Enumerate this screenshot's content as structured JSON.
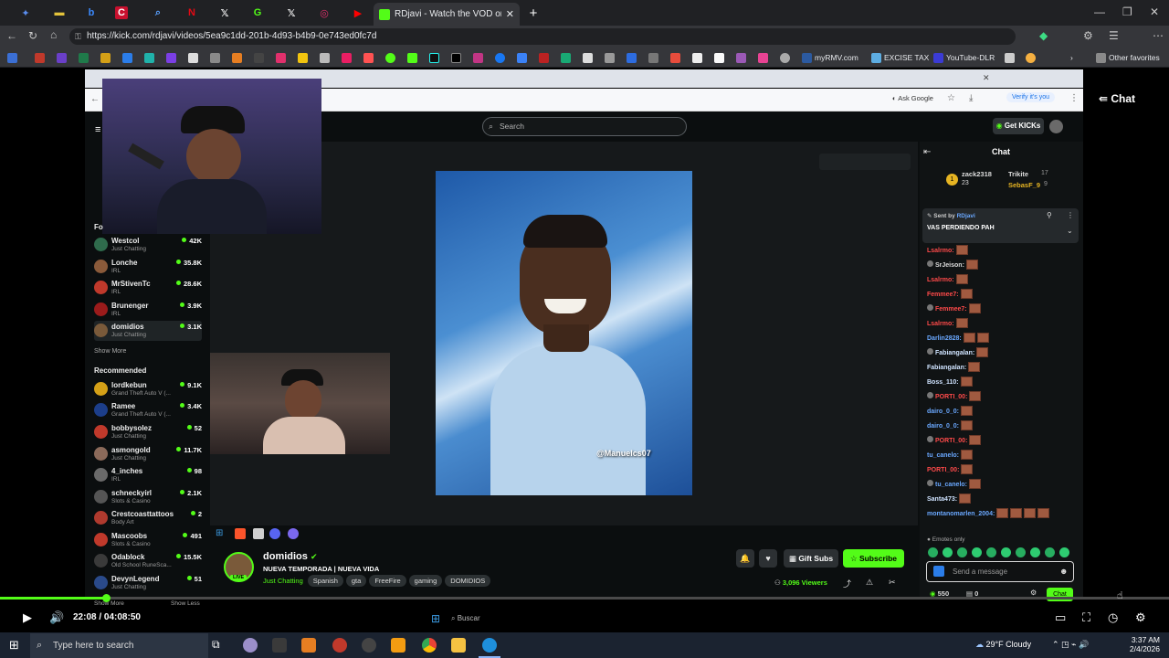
{
  "browser": {
    "active_tab_title": "RDjavi - Watch the VOD on Kick",
    "url": "https://kick.com/rdjavi/videos/5ea9c1dd-201b-4d93-b4b9-0e743ed0fc7d",
    "bookmarks": [
      "myRMV.com",
      "EXCISE TAX",
      "YouTube-DLR"
    ],
    "other_favorites": "Other favorites"
  },
  "inner_browser": {
    "ask_google": "Ask Google",
    "verify": "Verify it's you"
  },
  "kick": {
    "search_placeholder": "Search",
    "get_kicks": "Get KICKs",
    "chat_title": "Chat",
    "chat_header_button": "Chat"
  },
  "sidebar": {
    "followed_label": "Fo",
    "followed": [
      {
        "name": "Westcol",
        "category": "Just Chatting",
        "viewers": "42K"
      },
      {
        "name": "Lonche",
        "category": "IRL",
        "viewers": "35.8K"
      },
      {
        "name": "MrStivenTc",
        "category": "IRL",
        "viewers": "28.6K"
      },
      {
        "name": "Brunenger",
        "category": "IRL",
        "viewers": "3.9K"
      },
      {
        "name": "domidios",
        "category": "Just Chatting",
        "viewers": "3.1K"
      }
    ],
    "show_more": "Show More",
    "recommended_label": "Recommended",
    "recommended": [
      {
        "name": "lordkebun",
        "category": "Grand Theft Auto V (...",
        "viewers": "9.1K"
      },
      {
        "name": "Ramee",
        "category": "Grand Theft Auto V (...",
        "viewers": "3.4K"
      },
      {
        "name": "bobbysolez",
        "category": "Just Chatting",
        "viewers": "52"
      },
      {
        "name": "asmongold",
        "category": "Just Chatting",
        "viewers": "11.7K"
      },
      {
        "name": "4_inches",
        "category": "IRL",
        "viewers": "98"
      },
      {
        "name": "schneckyirl",
        "category": "Slots & Casino",
        "viewers": "2.1K"
      },
      {
        "name": "Crestcoasttattoos",
        "category": "Body Art",
        "viewers": "2"
      },
      {
        "name": "Mascoobs",
        "category": "Slots & Casino",
        "viewers": "491"
      },
      {
        "name": "Odablock",
        "category": "Old School RuneSca...",
        "viewers": "15.5K"
      },
      {
        "name": "DevynLegend",
        "category": "Just Chatting",
        "viewers": "51"
      }
    ],
    "show_more_2": "Show More",
    "show_less": "Show Less"
  },
  "chat": {
    "top_gifters": [
      {
        "name": "zack2318",
        "count": "23"
      },
      {
        "name": "Trikite",
        "count": "17"
      },
      {
        "name": "SebasF_9",
        "count": "9"
      }
    ],
    "pinned_sent_by": "Sent by",
    "pinned_user": "RDjavi",
    "pinned_text": "VAS PERDIENDO PAH",
    "messages": [
      {
        "user": "Lsalrmo:",
        "color": "#ff4a4a"
      },
      {
        "user": "SrJeison:",
        "color": "#dddddd"
      },
      {
        "user": "Lsalrmo:",
        "color": "#ff4a4a"
      },
      {
        "user": "Femmee7:",
        "color": "#ff4a4a"
      },
      {
        "user": "Femmee7:",
        "color": "#ff4a4a"
      },
      {
        "user": "Lsalrmo:",
        "color": "#ff4a4a"
      },
      {
        "user": "Darlin2828:",
        "color": "#6aa8ff"
      },
      {
        "user": "Fabiangalan:",
        "color": "#cfe3ff"
      },
      {
        "user": "Fabiangalan:",
        "color": "#cfe3ff"
      },
      {
        "user": "Boss_110:",
        "color": "#cfe3ff"
      },
      {
        "user": "PORTI_00:",
        "color": "#ff4a4a"
      },
      {
        "user": "dairo_0_0:",
        "color": "#6aa8ff"
      },
      {
        "user": "dairo_0_0:",
        "color": "#6aa8ff"
      },
      {
        "user": "PORTI_00:",
        "color": "#ff4a4a"
      },
      {
        "user": "tu_canelo:",
        "color": "#6aa8ff"
      },
      {
        "user": "PORTI_00:",
        "color": "#ff4a4a"
      },
      {
        "user": "tu_canelo:",
        "color": "#6aa8ff"
      },
      {
        "user": "Santa473:",
        "color": "#cfe3ff"
      },
      {
        "user": "montanomarlen_2004:",
        "color": "#6aa8ff"
      }
    ],
    "emotes_only": "Emotes only",
    "input_placeholder": "Send a message",
    "kicks_balance": "550",
    "other_count": "0",
    "send_button": "Chat"
  },
  "stream": {
    "streamer": "domidios",
    "title": "NUEVA TEMPORADA | NUEVA VIDA",
    "category": "Just Chatting",
    "tags": [
      "Spanish",
      "gta",
      "FreeFire",
      "gaming",
      "DOMIDIOS"
    ],
    "viewers": "3,096 Viewers",
    "gift_subs": "Gift Subs",
    "subscribe": "Subscribe",
    "photo_watermark": "@Manuelcs07",
    "badge_live": "LIVE"
  },
  "player": {
    "timecode": "22:08 / 04:08:50",
    "progress_fraction": 0.091
  },
  "taskbar": {
    "search_placeholder": "Type here to search",
    "inner_search": "Buscar",
    "weather": "29°F  Cloudy",
    "time": "3:37 AM",
    "date": "2/4/2026"
  },
  "colors": {
    "kick_green": "#53fc18"
  }
}
